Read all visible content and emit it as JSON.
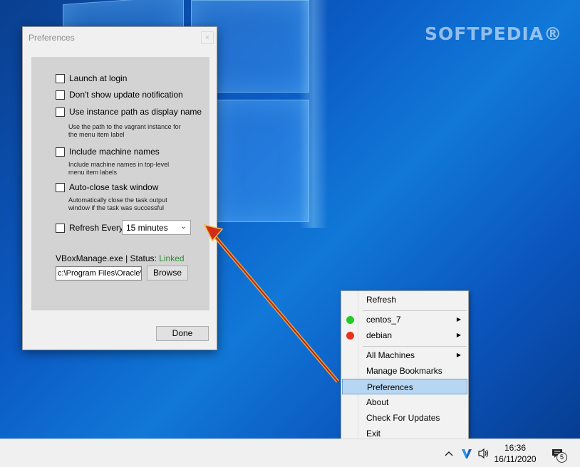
{
  "watermark": "SOFTPEDIA®",
  "dialog": {
    "title": "Preferences",
    "close_glyph": "×",
    "options": [
      {
        "label": "Launch at login",
        "checked": false
      },
      {
        "label": "Don't show update notification",
        "checked": false
      },
      {
        "label": "Use instance path as display name",
        "checked": false,
        "hint": "Use the path to the vagrant instance for the menu item label"
      },
      {
        "label": "Include machine names",
        "checked": false,
        "hint": "Include machine names in top-level menu item labels"
      },
      {
        "label": "Auto-close task window",
        "checked": false,
        "hint": "Automatically close the task output window if the task was successful"
      },
      {
        "label": "Refresh Every",
        "checked": false
      }
    ],
    "refresh_interval": "15 minutes",
    "vboxmanage_label": "VBoxManage.exe | Status:",
    "vboxmanage_status": "Linked",
    "vboxmanage_path": "c:\\Program Files\\Oracle\\",
    "browse_label": "Browse",
    "done_label": "Done"
  },
  "menu": {
    "items": [
      {
        "label": "Refresh"
      },
      {
        "label": "centos_7",
        "status_color": "#22cc22",
        "submenu": true
      },
      {
        "label": "debian",
        "status_color": "#e8321e",
        "submenu": true
      },
      {
        "label": "All Machines",
        "submenu": true
      },
      {
        "label": "Manage Bookmarks"
      },
      {
        "label": "Preferences",
        "selected": true
      },
      {
        "label": "About"
      },
      {
        "label": "Check For Updates"
      },
      {
        "label": "Exit"
      }
    ]
  },
  "taskbar": {
    "time": "16:36",
    "date": "16/11/2020",
    "notification_count": "5"
  },
  "colors": {
    "status_linked": "#2e8b2e",
    "menu_highlight": "#b7d6f2"
  }
}
